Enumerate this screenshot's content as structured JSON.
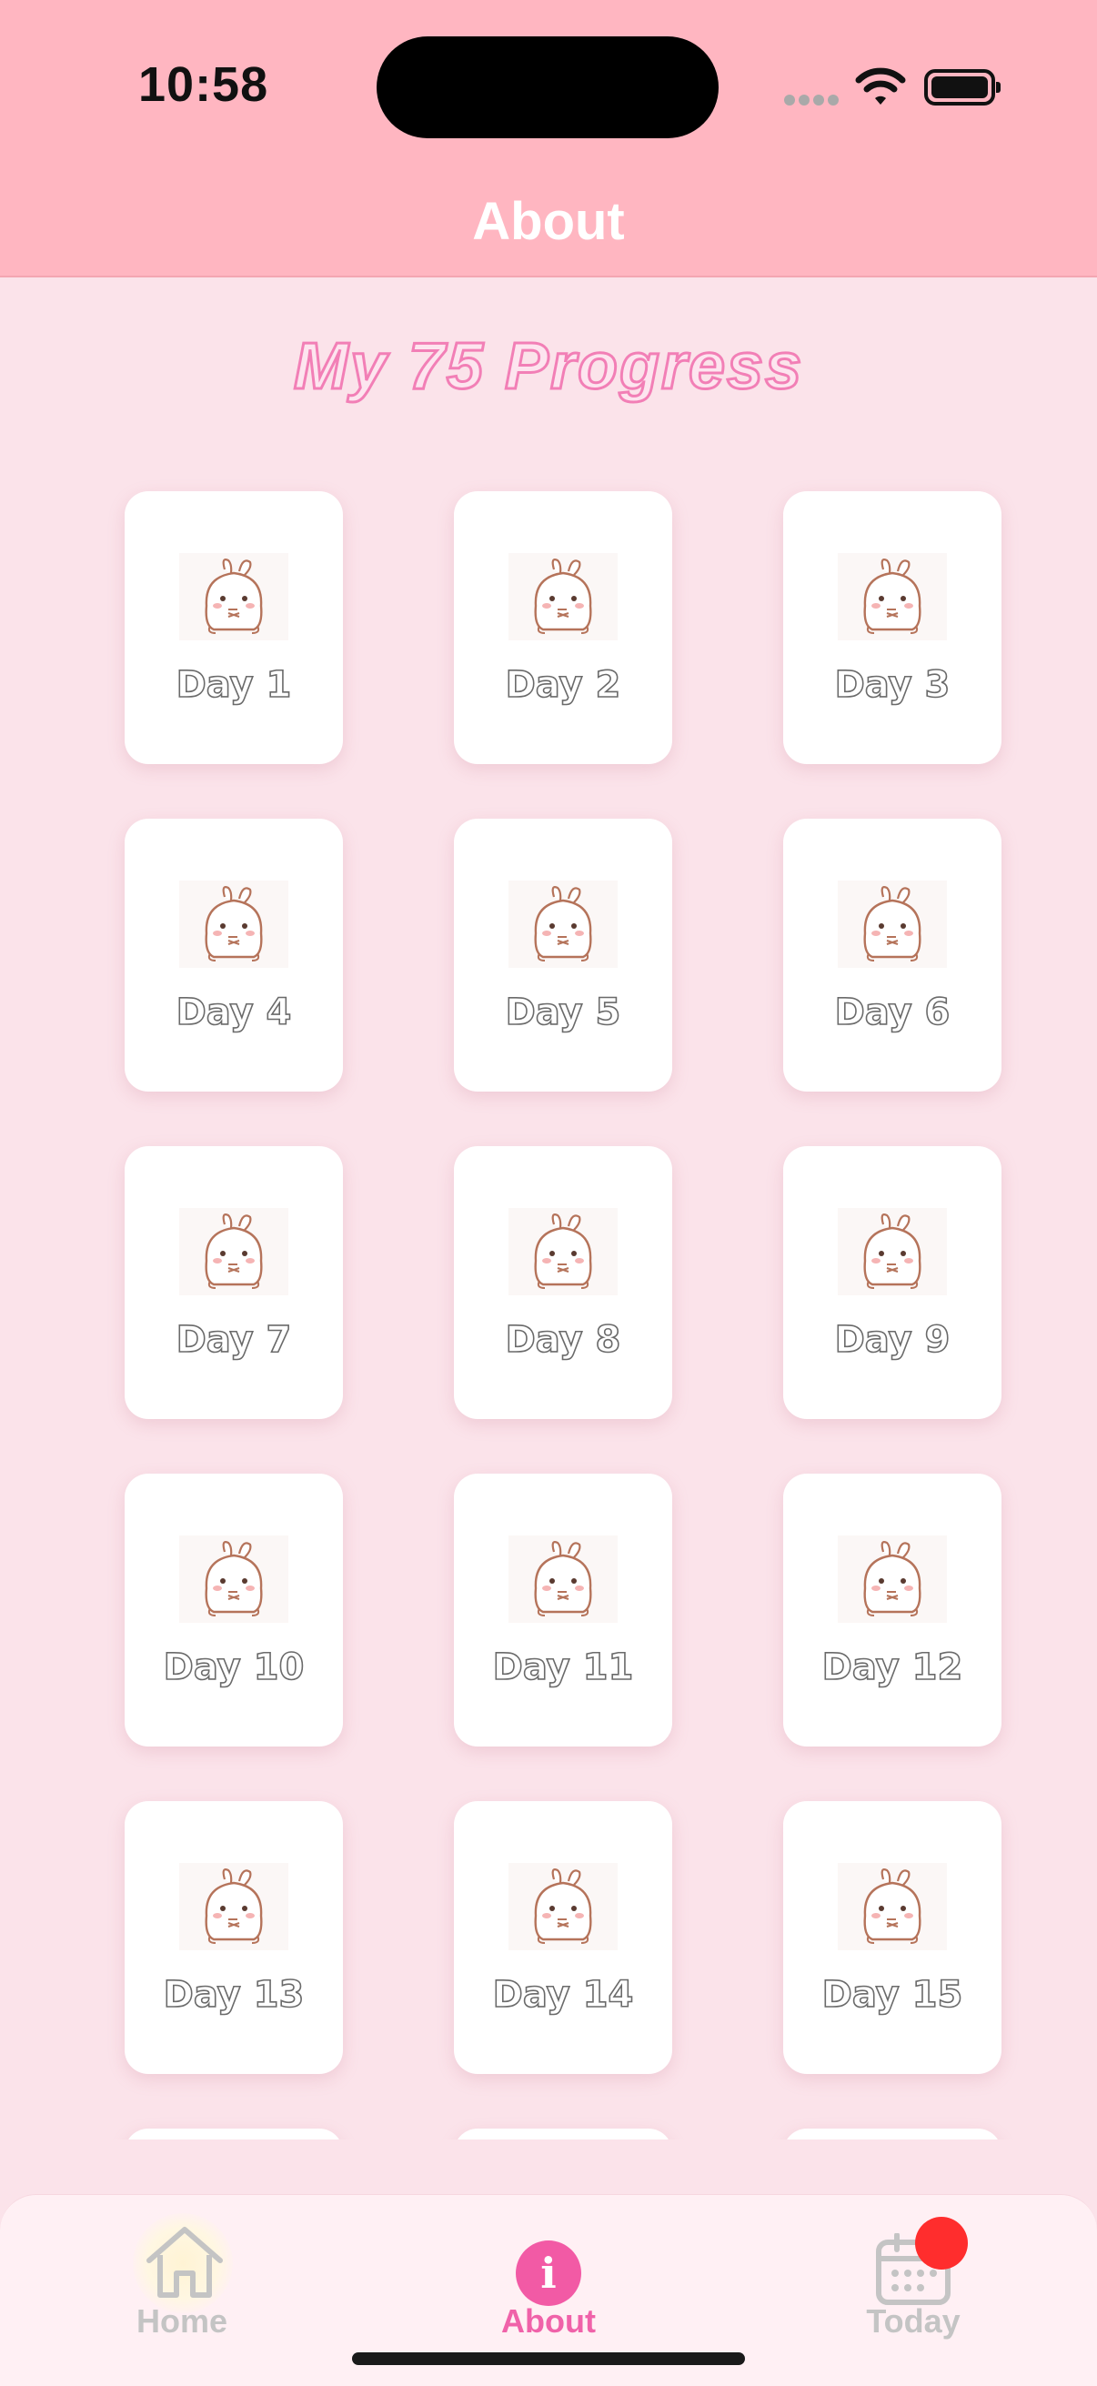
{
  "status_bar": {
    "time": "10:58"
  },
  "header": {
    "title": "About"
  },
  "page": {
    "title": "My 75 Progress"
  },
  "days": [
    {
      "label": "Day 1"
    },
    {
      "label": "Day 2"
    },
    {
      "label": "Day 3"
    },
    {
      "label": "Day 4"
    },
    {
      "label": "Day 5"
    },
    {
      "label": "Day 6"
    },
    {
      "label": "Day 7"
    },
    {
      "label": "Day 8"
    },
    {
      "label": "Day 9"
    },
    {
      "label": "Day 10"
    },
    {
      "label": "Day 11"
    },
    {
      "label": "Day 12"
    },
    {
      "label": "Day 13"
    },
    {
      "label": "Day 14"
    },
    {
      "label": "Day 15"
    },
    {
      "label": ""
    },
    {
      "label": ""
    },
    {
      "label": ""
    }
  ],
  "tabbar": {
    "items": [
      {
        "label": "Home",
        "icon": "home-icon",
        "active": false
      },
      {
        "label": "About",
        "icon": "info-icon",
        "active": true
      },
      {
        "label": "Today",
        "icon": "calendar-icon",
        "active": false,
        "badge": true
      }
    ]
  },
  "colors": {
    "header_bg": "#ffb6c1",
    "page_bg": "#fbe3ea",
    "accent_pink": "#f25aa5",
    "badge_red": "#ff2d2d"
  }
}
